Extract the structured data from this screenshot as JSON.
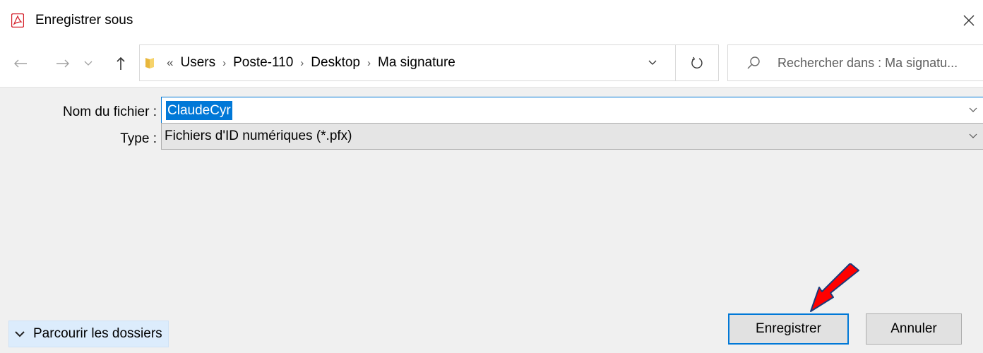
{
  "window": {
    "title": "Enregistrer sous",
    "app_icon": "pdf-icon",
    "close_icon": "close-icon"
  },
  "nav": {
    "back_icon": "arrow-left-icon",
    "forward_icon": "arrow-right-icon",
    "history_icon": "chevron-down-icon",
    "up_icon": "arrow-up-icon",
    "overflow": "«",
    "breadcrumb": [
      "Users",
      "Poste-110",
      "Desktop",
      "Ma signature"
    ],
    "refresh_icon": "refresh-icon"
  },
  "search": {
    "placeholder": "Rechercher dans : Ma signatu..."
  },
  "form": {
    "filename_label": "Nom du fichier :",
    "filename_value": "ClaudeCyr",
    "type_label": "Type :",
    "type_value": "Fichiers d'ID numériques (*.pfx)"
  },
  "footer": {
    "browse_label": "Parcourir les dossiers",
    "save_label": "Enregistrer",
    "cancel_label": "Annuler"
  },
  "colors": {
    "accent": "#0078d7",
    "panel_bg": "#f0f0f0",
    "annotation_arrow": "#ff0000"
  }
}
